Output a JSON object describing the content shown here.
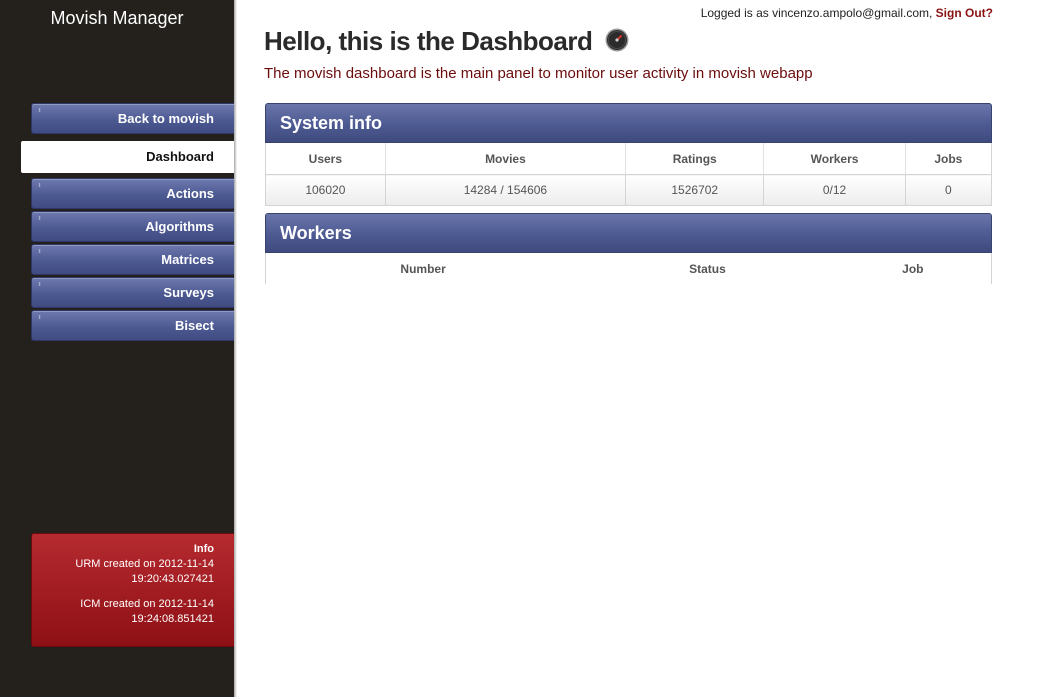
{
  "sidebar": {
    "app_title": "Movish Manager",
    "items": [
      {
        "label": "Back to movish"
      },
      {
        "label": "Dashboard",
        "active": true
      },
      {
        "label": "Actions"
      },
      {
        "label": "Algorithms"
      },
      {
        "label": "Matrices"
      },
      {
        "label": "Surveys"
      },
      {
        "label": "Bisect"
      }
    ],
    "info": {
      "title": "Info",
      "urm_line1": "URM created on 2012-11-14",
      "urm_line2": "19:20:43.027421",
      "icm_line1": "ICM created on 2012-11-14",
      "icm_line2": "19:24:08.851421"
    }
  },
  "header": {
    "login_prefix": "Logged is as vincenzo.ampolo@gmail.com,",
    "sign_out": "Sign Out?",
    "title": "Hello, this is the Dashboard",
    "title_icon": "gauge-icon",
    "subtitle": "The movish dashboard is the main panel to monitor user activity in movish webapp"
  },
  "system_info": {
    "title": "System info",
    "columns": [
      "Users",
      "Movies",
      "Ratings",
      "Workers",
      "Jobs"
    ],
    "row": [
      "106020",
      "14284 / 154606",
      "1526702",
      "0/12",
      "0"
    ]
  },
  "workers": {
    "title": "Workers",
    "columns": [
      "Number",
      "Status",
      "Job"
    ]
  },
  "colors": {
    "sidebar_bg": "#24211d",
    "nav_blue": "#4d5a92",
    "info_red": "#8e1015",
    "subtitle_red": "#6b0c0c",
    "link_red": "#8b1313"
  }
}
